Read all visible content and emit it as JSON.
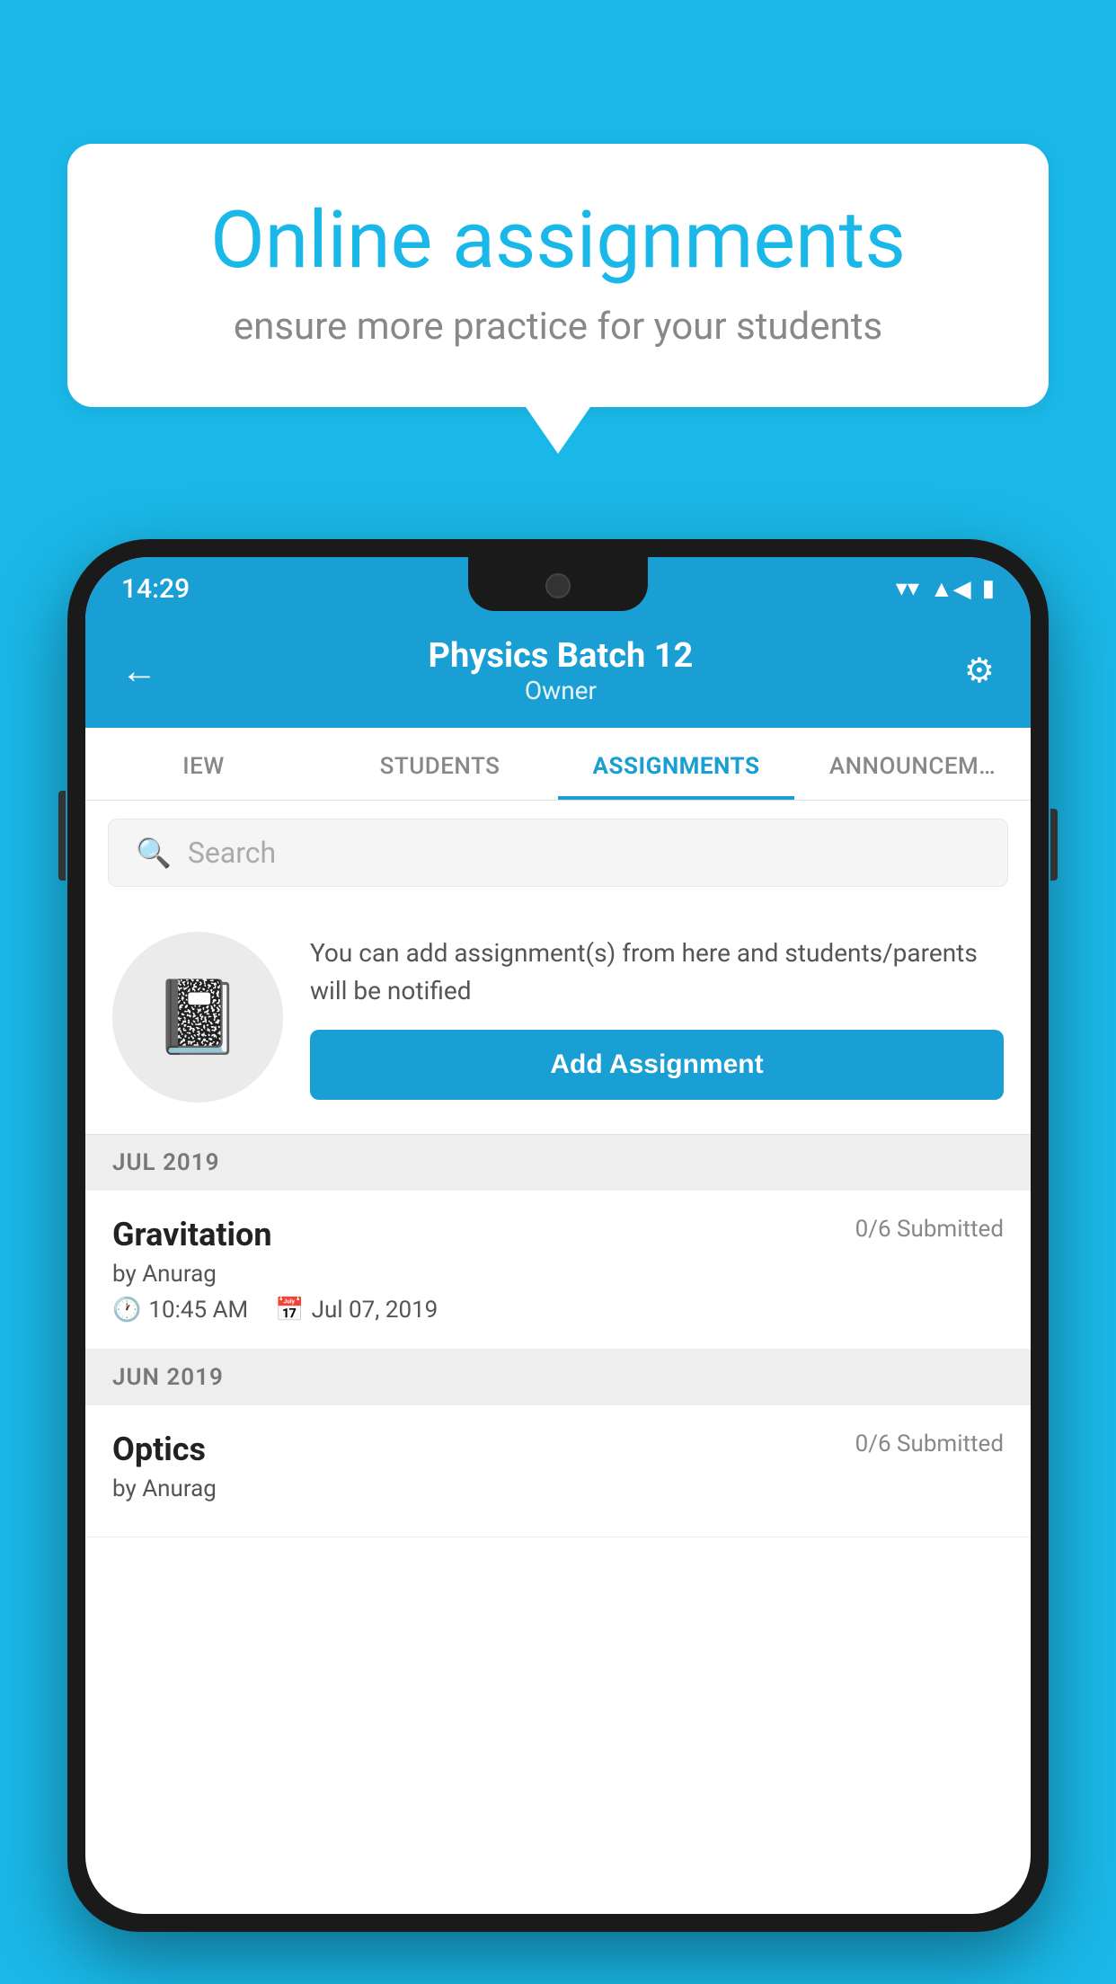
{
  "background_color": "#1ab8e8",
  "speech_bubble": {
    "title": "Online assignments",
    "subtitle": "ensure more practice for your students"
  },
  "status_bar": {
    "time": "14:29",
    "wifi": "▾",
    "signal": "▲",
    "battery": "▮"
  },
  "header": {
    "title": "Physics Batch 12",
    "subtitle": "Owner",
    "back_label": "←",
    "settings_label": "⚙"
  },
  "tabs": [
    {
      "label": "IEW",
      "active": false
    },
    {
      "label": "STUDENTS",
      "active": false
    },
    {
      "label": "ASSIGNMENTS",
      "active": true
    },
    {
      "label": "ANNOUNCEM…",
      "active": false
    }
  ],
  "search": {
    "placeholder": "Search"
  },
  "promo": {
    "text": "You can add assignment(s) from here and students/parents will be notified",
    "button_label": "Add Assignment"
  },
  "sections": [
    {
      "month_label": "JUL 2019",
      "assignments": [
        {
          "title": "Gravitation",
          "submitted": "0/6 Submitted",
          "author": "by Anurag",
          "time": "10:45 AM",
          "date": "Jul 07, 2019"
        }
      ]
    },
    {
      "month_label": "JUN 2019",
      "assignments": [
        {
          "title": "Optics",
          "submitted": "0/6 Submitted",
          "author": "by Anurag",
          "time": "",
          "date": ""
        }
      ]
    }
  ]
}
